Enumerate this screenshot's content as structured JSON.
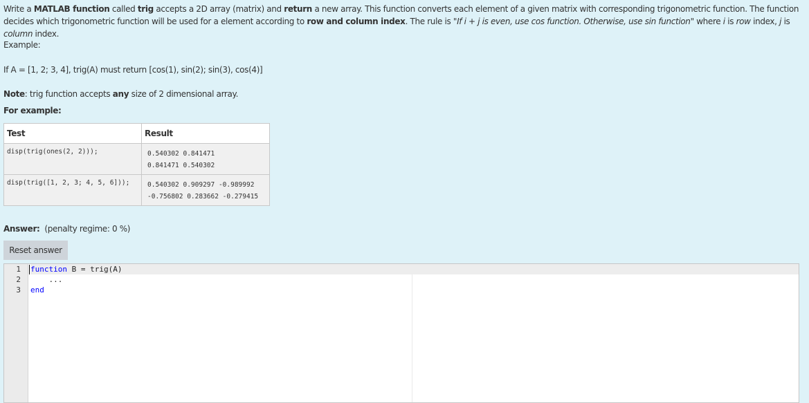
{
  "question": {
    "intro": {
      "t1": "Write a ",
      "b1": "MATLAB function",
      "t2": " called ",
      "b2": "trig",
      "t3": " accepts a 2D array (matrix) and ",
      "b3": "return",
      "t4": " a new array. This function converts each element of a given matrix with corresponding trigonometric function. The function decides which trigonometric function will be used for a element according to ",
      "b4": "row and column index",
      "t5": ". The rule is \"",
      "i1": "If i + j is even, use cos function. Otherwise, use sin function",
      "t6": "\" where ",
      "i2": "i",
      "t7": " is ",
      "i3": "row",
      "t8": " index, ",
      "i4": "j",
      "t9": " is ",
      "i5": "column",
      "t10": " index."
    },
    "example_label": "Example:",
    "if_a_text": "If A = [1, 2; 3, 4], trig(A) must return [cos(1), sin(2); sin(3), cos(4)]",
    "note_label": "Note",
    "note_t1": ": trig function accepts ",
    "note_bold": "any",
    "note_t2": " size of 2 dimensional array.",
    "for_example_label": "For example:"
  },
  "examples_table": {
    "headers": [
      "Test",
      "Result"
    ],
    "rows": [
      {
        "test": "disp(trig(ones(2, 2)));",
        "result": [
          "0.540302 0.841471",
          "0.841471 0.540302"
        ]
      },
      {
        "test": "disp(trig([1, 2, 3; 4, 5, 6]));",
        "result": [
          "0.540302 0.909297 -0.989992",
          "-0.756802 0.283662 -0.279415"
        ]
      }
    ]
  },
  "answer": {
    "label": "Answer:",
    "penalty": "(penalty regime: 0 %)",
    "reset_label": "Reset answer"
  },
  "editor": {
    "lines": [
      {
        "num": "1",
        "kw": "function",
        "rest": " B = trig(A)"
      },
      {
        "num": "2",
        "kw": "",
        "rest": "    ..."
      },
      {
        "num": "3",
        "kw": "end",
        "rest": ""
      }
    ]
  }
}
